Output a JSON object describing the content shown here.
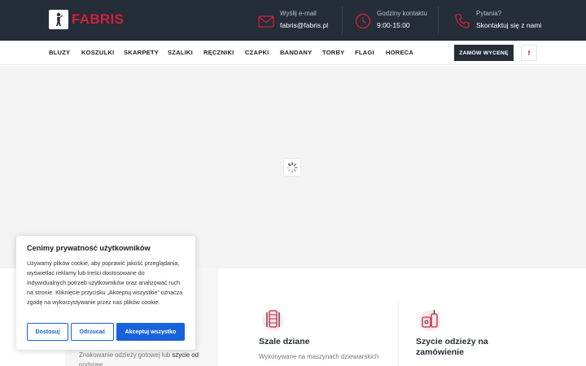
{
  "header": {
    "logo_text": "FABRIS",
    "brand_color": "#d1213a",
    "background": "#242d38",
    "contacts": [
      {
        "icon": "envelope-icon",
        "label": "Wyślij e-mail",
        "value": "fabris@fabris.pl"
      },
      {
        "icon": "clock-icon",
        "label": "Godziny kontaktu",
        "value": "9:00-15:00"
      },
      {
        "icon": "phone-icon",
        "label": "Pytania?",
        "value": "Skontaktuj się z nami"
      }
    ]
  },
  "nav": {
    "items": [
      "BLUZY",
      "KOSZULKI",
      "SKARPETY",
      "SZALIKI",
      "RĘCZNIKI",
      "CZAPKI",
      "BANDANY",
      "TORBY",
      "FLAGI",
      "HORECA"
    ],
    "order_button": "ZAMÓW WYCENĘ",
    "facebook": "f"
  },
  "features": {
    "left_text_plain": "Znakowanie odzieży gotowej lub ",
    "left_text_link": "szycie od",
    "left_text_tail": "podstaw",
    "items": [
      {
        "icon": "scarf-icon",
        "title": "Szale dziane",
        "text": "Wykonywane na maszynach dziewiarskich"
      },
      {
        "icon": "sewing-icon",
        "title": "Szycie odzieży na zamówienie",
        "text": ""
      }
    ]
  },
  "cookie": {
    "title": "Cenimy prywatność użytkowników",
    "text": "Używamy plików cookie, aby poprawić jakość przeglądania, wyświetlać reklamy lub treści dostosowane do indywidualnych potrzeb użytkowników oraz analizować ruch na stronie. Kliknięcie przycisku „Akceptuj wszystkie” oznacza zgodę na wykorzystywanie przez nas plików cookie.",
    "buttons": {
      "customize": "Dostosuj",
      "reject": "Odrzucać",
      "accept": "Akceptuj wszystko"
    },
    "accent": "#1863dc"
  }
}
